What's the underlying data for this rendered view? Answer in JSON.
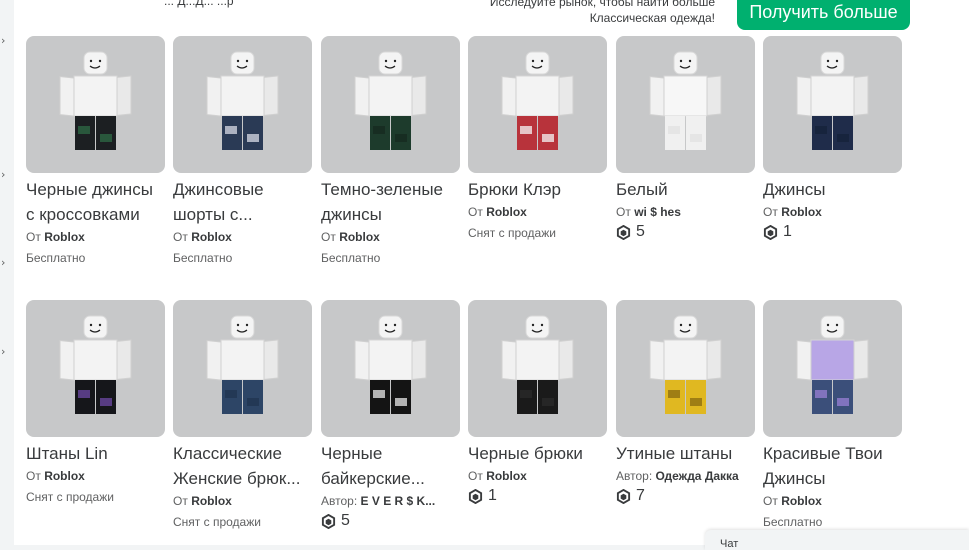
{
  "header": {
    "left_text": "... Д...Д...      ...р",
    "promo_line1": "Исследуйте рынок, чтобы найти больше",
    "promo_line2": "Классическая одежда!",
    "get_more_label": "Получить больше"
  },
  "left_arrows": [
    "›",
    "›",
    "›",
    "›"
  ],
  "items": [
    {
      "name": "Черные джинсы с кроссовками",
      "creator_prefix": "От",
      "creator": "Roblox",
      "price": "Бесплатно",
      "robux": null,
      "legs": "#1c1f22",
      "accent": "#2e6b45",
      "shirt": "#f3f3f3"
    },
    {
      "name": "Джинсовые шорты с...",
      "creator_prefix": "От",
      "creator": "Roblox",
      "price": "Бесплатно",
      "robux": null,
      "legs": "#2a3a55",
      "accent": "#d8dbe6",
      "shirt": "#f3f3f3"
    },
    {
      "name": "Темно-зеленые джинсы",
      "creator_prefix": "От",
      "creator": "Roblox",
      "price": "Бесплатно",
      "robux": null,
      "legs": "#1d3b2c",
      "accent": "#152a1f",
      "shirt": "#f3f3f3"
    },
    {
      "name": "Брюки Клэр",
      "creator_prefix": "От",
      "creator": "Roblox",
      "price": "Снят с продажи",
      "robux": null,
      "legs": "#b8333b",
      "accent": "#f5f5f5",
      "shirt": "#f3f3f3"
    },
    {
      "name": "Белый",
      "creator_prefix": "От",
      "creator": "wi $ hes",
      "price": "",
      "robux": "5",
      "legs": "#f0f0f0",
      "accent": "#e2e2e2",
      "shirt": "#f7f7f7"
    },
    {
      "name": "Джинсы",
      "creator_prefix": "От",
      "creator": "Roblox",
      "price": "",
      "robux": "1",
      "legs": "#1f2c4a",
      "accent": "#16213a",
      "shirt": "#f3f3f3"
    },
    {
      "name": "Штаны Lin",
      "creator_prefix": "От",
      "creator": "Roblox",
      "price": "Снят с продажи",
      "robux": null,
      "legs": "#15161a",
      "accent": "#6d4aa6",
      "shirt": "#f3f3f3"
    },
    {
      "name": "Классические Женские брюк...",
      "creator_prefix": "От",
      "creator": "Roblox",
      "price": "Снят с продажи",
      "robux": null,
      "legs": "#2d4566",
      "accent": "#203450",
      "shirt": "#f3f3f3"
    },
    {
      "name": "Черные байкерские...",
      "creator_prefix": "Автор:",
      "creator": "E V E R $ K...",
      "price": "",
      "robux": "5",
      "legs": "#141414",
      "accent": "#e8e8e8",
      "shirt": "#f3f3f3"
    },
    {
      "name": "Черные брюки",
      "creator_prefix": "От",
      "creator": "Roblox",
      "price": "",
      "robux": "1",
      "legs": "#1a1a1a",
      "accent": "#2b2b2b",
      "shirt": "#f3f3f3"
    },
    {
      "name": "Утиные штаны",
      "creator_prefix": "Автор:",
      "creator": "Одежда Дакка",
      "price": "",
      "robux": "7",
      "legs": "#e0b821",
      "accent": "#8a6b10",
      "shirt": "#f3f3f3"
    },
    {
      "name": "Красивые Твои Джинсы",
      "creator_prefix": "От",
      "creator": "Roblox",
      "price": "Бесплатно",
      "robux": null,
      "legs": "#3b4f7a",
      "accent": "#9a7fd6",
      "shirt": "#b8a6e6"
    }
  ],
  "chat": {
    "label": "Чат"
  },
  "colors": {
    "accent_green": "#00b06f",
    "thumb_bg": "#c7c8c9"
  }
}
